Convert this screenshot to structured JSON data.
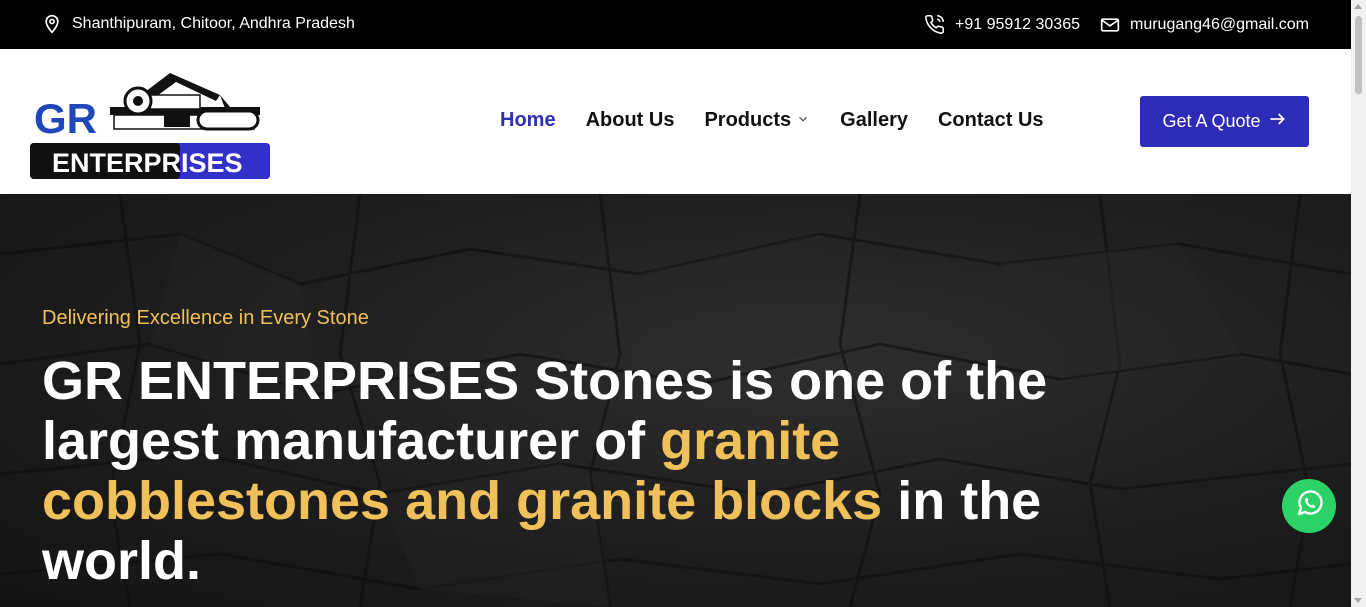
{
  "topbar": {
    "location": "Shanthipuram, Chitoor, Andhra Pradesh",
    "phone": "+91 95912 30365",
    "email": "murugang46@gmail.com",
    "location_icon": "map-pin-icon",
    "phone_icon": "phone-icon",
    "email_icon": "envelope-icon"
  },
  "logo": {
    "initials": "GR",
    "name": "ENTERPRISES"
  },
  "nav": {
    "items": [
      {
        "label": "Home",
        "active": true
      },
      {
        "label": "About Us"
      },
      {
        "label": "Products",
        "has_dropdown": true
      },
      {
        "label": "Gallery"
      },
      {
        "label": "Contact Us"
      }
    ]
  },
  "cta": {
    "label": "Get A Quote",
    "icon": "arrow-right-icon"
  },
  "hero": {
    "tagline": "Delivering Excellence in Every Stone",
    "headline_part1": "GR ENTERPRISES Stones is one of the largest manufacturer of",
    "headline_highlight": "granite cobblestones and granite blocks",
    "headline_part2": "in the world."
  },
  "colors": {
    "accent": "#2d2bb8",
    "highlight": "#f0c15a",
    "topbar_bg": "#000000",
    "whatsapp": "#2bd366"
  }
}
